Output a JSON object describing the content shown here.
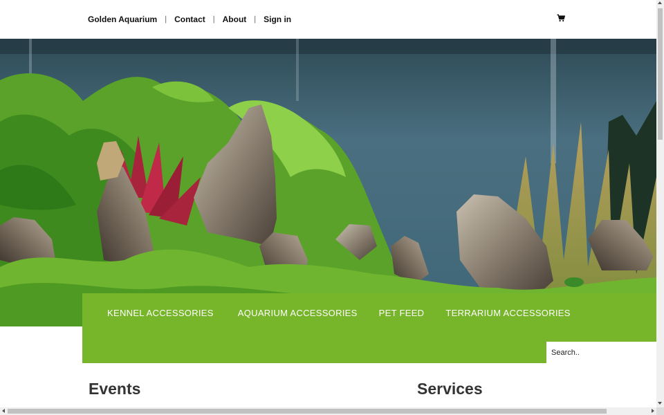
{
  "nav": {
    "brand": "Golden Aquarium",
    "separator": "|",
    "links": [
      {
        "label": "Contact"
      },
      {
        "label": "About"
      },
      {
        "label": "Sign in"
      }
    ],
    "cart_icon": "shopping-cart-icon"
  },
  "hero": {
    "image": "aquascape-aquarium-photo"
  },
  "categories": [
    {
      "label": "KENNEL ACCESSORIES"
    },
    {
      "label": "AQUARIUM ACCESSORIES"
    },
    {
      "label": "PET FEED"
    },
    {
      "label": "TERRARIUM ACCESSORIES"
    }
  ],
  "search": {
    "placeholder": "Search.."
  },
  "sections": {
    "events": "Events",
    "services": "Services"
  },
  "colors": {
    "accent_green": "#77b52a",
    "heading": "#333333",
    "nav_text": "#111111"
  }
}
